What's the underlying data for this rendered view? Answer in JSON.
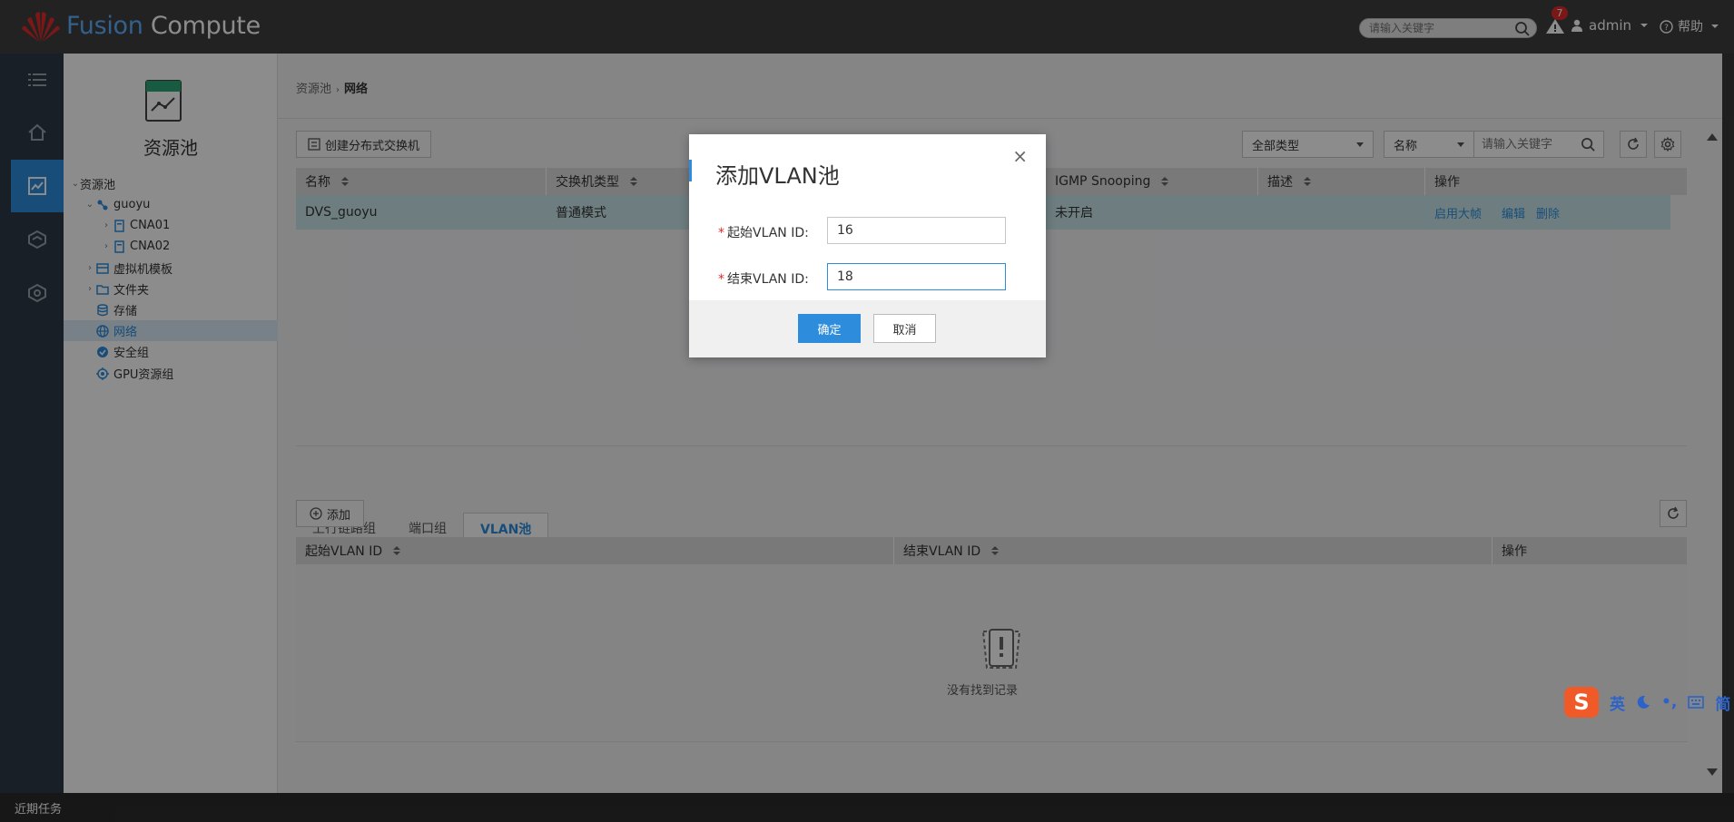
{
  "app": {
    "brand_prefix": "Fusion",
    "brand_suffix": "Compute"
  },
  "topbar": {
    "search_placeholder": "请输入关键字",
    "alarm_count": "7",
    "user": "admin",
    "help": "帮助"
  },
  "nav": {
    "title": "资源池",
    "tree": [
      {
        "label": "资源池"
      },
      {
        "label": "guoyu"
      },
      {
        "label": "CNA01"
      },
      {
        "label": "CNA02"
      },
      {
        "label": "虚拟机模板"
      },
      {
        "label": "文件夹"
      },
      {
        "label": "存储"
      },
      {
        "label": "网络"
      },
      {
        "label": "安全组"
      },
      {
        "label": "GPU资源组"
      }
    ]
  },
  "main": {
    "breadcrumb": {
      "root": "资源池",
      "current": "网络"
    },
    "create_dvs_label": "创建分布式交换机",
    "type_filter": "全部类型",
    "field_filter": "名称",
    "keyword_placeholder": "请输入关键字",
    "columns": [
      "名称",
      "交换机类型",
      "IGMP Snooping",
      "描述",
      "操作"
    ],
    "rows": [
      {
        "name": "DVS_guoyu",
        "type": "普通模式",
        "igmp": "未开启",
        "desc": "",
        "actions": [
          "启用大帧",
          "编辑",
          "删除"
        ]
      }
    ],
    "tabs": [
      "上行链路组",
      "端口组",
      "VLAN池"
    ],
    "add_label": "添加",
    "vlan_columns": [
      "起始VLAN ID",
      "结束VLAN ID",
      "操作"
    ],
    "empty_text": "没有找到记录"
  },
  "modal": {
    "title": "添加VLAN池",
    "start_label": "起始VLAN ID:",
    "start_value": "16",
    "end_label": "结束VLAN ID:",
    "end_value": "18",
    "ok": "确定",
    "cancel": "取消"
  },
  "statusbar": {
    "label": "近期任务"
  },
  "ime": {
    "items": [
      "英",
      "简"
    ]
  },
  "colors": {
    "accent": "#2d8ddc",
    "topbar": "#3f3f3f",
    "rail": "#2f3a48",
    "row_highlight": "#c9e6ea"
  }
}
